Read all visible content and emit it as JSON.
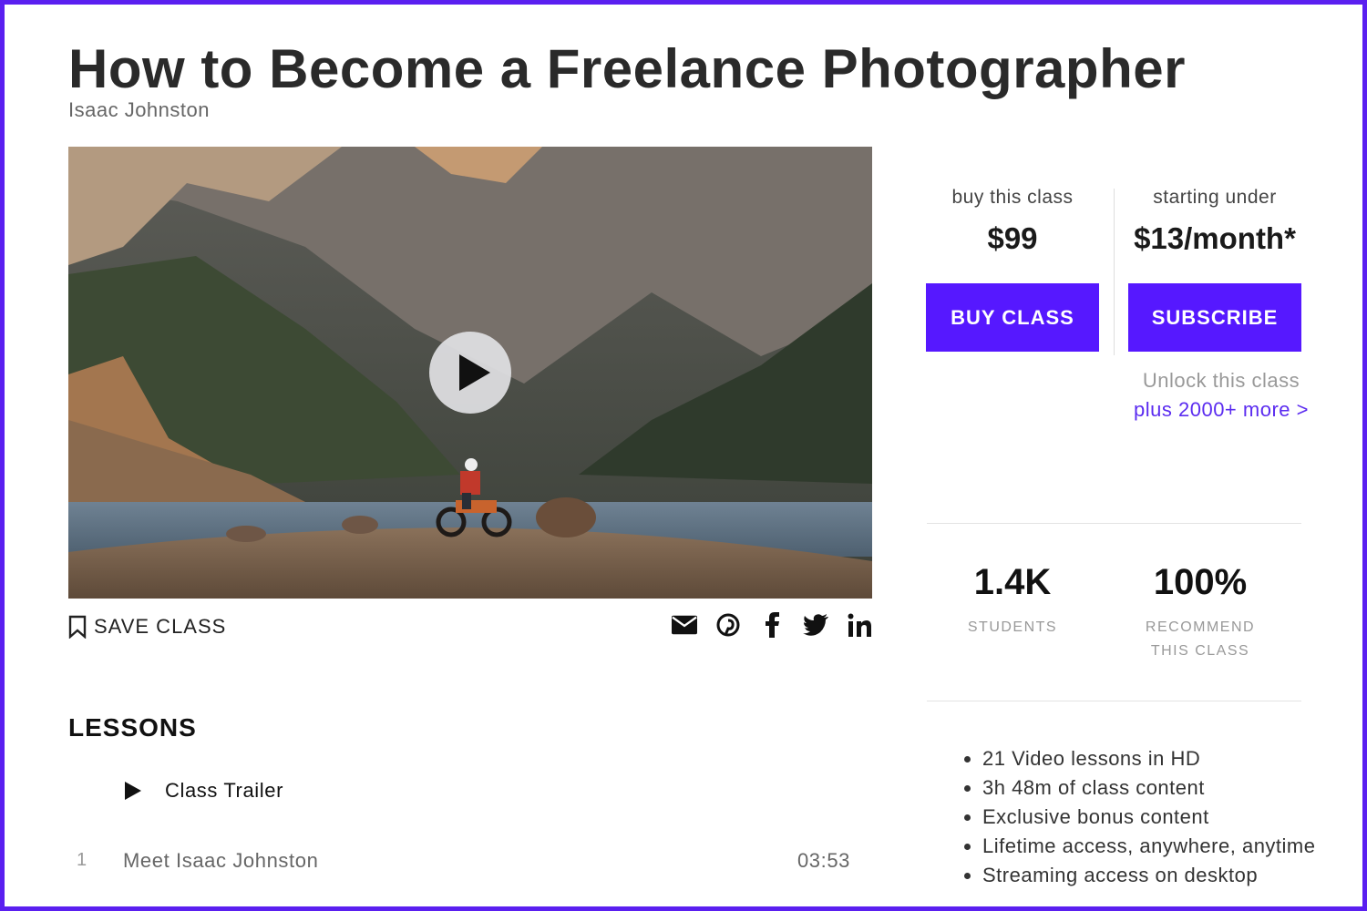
{
  "title": "How to Become a Freelance Photographer",
  "author": "Isaac Johnston",
  "actions": {
    "save_label": "SAVE CLASS"
  },
  "share_icons": [
    "envelope-icon",
    "pinterest-icon",
    "facebook-icon",
    "twitter-icon",
    "linkedin-icon"
  ],
  "lessons": {
    "heading": "LESSONS",
    "trailer": "Class Trailer",
    "items": [
      {
        "num": "1",
        "name": "Meet Isaac Johnston",
        "duration": "03:53"
      }
    ]
  },
  "purchase": {
    "buy_label": "buy this class",
    "buy_price": "$99",
    "buy_button": "BUY CLASS",
    "sub_label": "starting under",
    "sub_price": "$13/month*",
    "sub_button": "SUBSCRIBE",
    "unlock_line1": "Unlock this class",
    "unlock_line2": "plus 2000+ more >"
  },
  "stats": {
    "students_value": "1.4K",
    "students_label": "STUDENTS",
    "recommend_value": "100%",
    "recommend_label1": "RECOMMEND",
    "recommend_label2": "THIS CLASS"
  },
  "features": [
    "21 Video lessons in HD",
    "3h 48m of class content",
    "Exclusive bonus content",
    "Lifetime access, anywhere, anytime",
    "Streaming access on desktop"
  ],
  "colors": {
    "accent": "#5618ff",
    "frame": "#5a1ff0",
    "link": "#5b2cf0"
  }
}
